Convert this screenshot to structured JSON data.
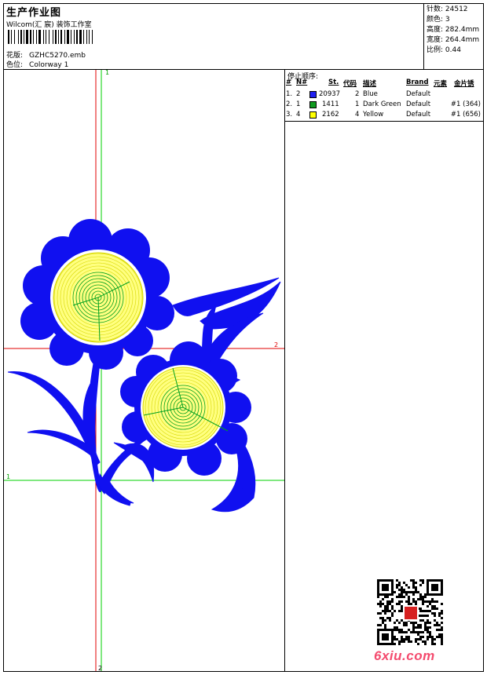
{
  "header": {
    "title": "生产作业图",
    "company": "Wilcom(汇 宸) 装饰工作室",
    "design_label": "花版:",
    "design_value": "GZHC5270.emb",
    "colorway_label": "色位:",
    "colorway_value": "Colorway 1"
  },
  "stats": {
    "stitches": "针数: 24512",
    "colors": "颜色: 3",
    "height": "高度: 282.4mm",
    "width": "宽度: 264.4mm",
    "scale": "比例: 0.44"
  },
  "guides": {
    "v1_label": "1",
    "v2_label": "2",
    "h1_label": "1",
    "h2_label": "2"
  },
  "stop_sequence": {
    "title": "停止顺序:",
    "headers": {
      "num": "#",
      "needle": "N#",
      "stitches": "St.",
      "code": "代码",
      "desc": "描述",
      "brand": "Brand",
      "element": "元素",
      "sequin": "金片锈"
    },
    "rows": [
      {
        "num": "1.",
        "needle": "2",
        "color": "#1f1ff0",
        "stitches": "20937",
        "code": "2",
        "desc": "Blue",
        "brand": "Default",
        "element": "",
        "sequin": ""
      },
      {
        "num": "2.",
        "needle": "1",
        "color": "#0f9a1f",
        "stitches": "1411",
        "code": "1",
        "desc": "Dark Green",
        "brand": "Default",
        "element": "",
        "sequin": "#1 (364)"
      },
      {
        "num": "3.",
        "needle": "4",
        "color": "#ffff00",
        "stitches": "2162",
        "code": "4",
        "desc": "Yellow",
        "brand": "Default",
        "element": "",
        "sequin": "#1 (656)"
      }
    ]
  },
  "watermark": {
    "site": "6xiu.com"
  },
  "colors": {
    "blue": "#1010f0",
    "green": "#00a020",
    "yellow": "#f0f000",
    "guide_red": "#e00000",
    "guide_green": "#00d000"
  }
}
